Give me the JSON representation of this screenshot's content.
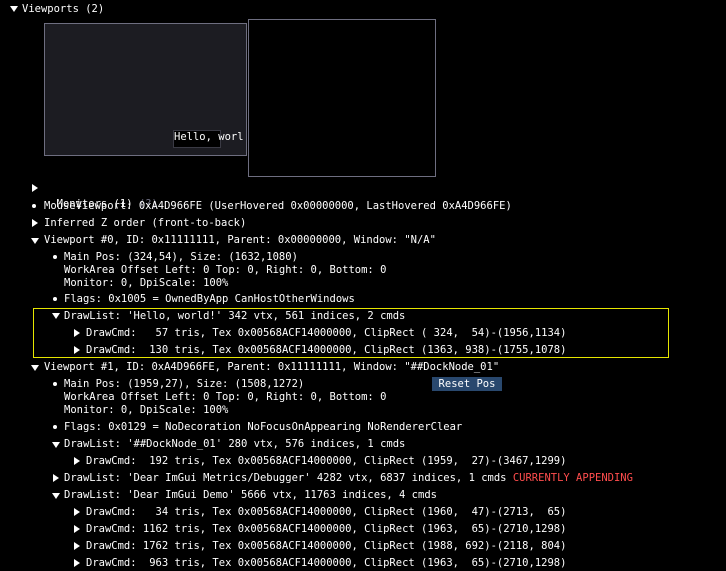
{
  "viewports_header": "Viewports (2)",
  "preview": {
    "hello_text": "Hello, worl"
  },
  "monitors": {
    "label": "Monitors (1)",
    "help": "(?)"
  },
  "mouse_viewport": "MouseViewport: 0xA4D966FE (UserHovered 0x00000000, LastHovered 0xA4D966FE)",
  "inferred_z": "Inferred Z order (front-to-back)",
  "viewport0": {
    "header": "Viewport #0, ID: 0x11111111, Parent: 0x00000000, Window: \"N/A\"",
    "pos_lines": [
      "Main Pos: (324,54), Size: (1632,1080)",
      "WorkArea Offset Left: 0 Top: 0, Right: 0, Bottom: 0",
      "Monitor: 0, DpiScale: 100%"
    ],
    "flags": "Flags: 0x1005 = OwnedByApp CanHostOtherWindows",
    "drawlist": "DrawList: 'Hello, world!' 342 vtx, 561 indices, 2 cmds",
    "drawcmds": [
      "DrawCmd:   57 tris, Tex 0x00568ACF14000000, ClipRect ( 324,  54)-(1956,1134)",
      "DrawCmd:  130 tris, Tex 0x00568ACF14000000, ClipRect (1363, 938)-(1755,1078)"
    ]
  },
  "viewport1": {
    "header": "Viewport #1, ID: 0xA4D966FE, Parent: 0x11111111, Window: \"##DockNode_01\"",
    "pos_lines": [
      "Main Pos: (1959,27), Size: (1508,1272)",
      "WorkArea Offset Left: 0 Top: 0, Right: 0, Bottom: 0",
      "Monitor: 0, DpiScale: 100%"
    ],
    "reset_pos": "Reset Pos",
    "flags": "Flags: 0x0129 = NoDecoration NoFocusOnAppearing NoRendererClear",
    "drawlist1": "DrawList: '##DockNode_01' 280 vtx, 576 indices, 1 cmds",
    "drawlist1_cmd": "DrawCmd:  192 tris, Tex 0x00568ACF14000000, ClipRect (1959,  27)-(3467,1299)",
    "drawlist2": "DrawList: 'Dear ImGui Metrics/Debugger' 4282 vtx, 6837 indices, 1 cmds",
    "drawlist2_status": "CURRENTLY APPENDING",
    "drawlist3": "DrawList: 'Dear ImGui Demo' 5666 vtx, 11763 indices, 4 cmds",
    "drawlist3_cmds": [
      "DrawCmd:   34 tris, Tex 0x00568ACF14000000, ClipRect (1960,  47)-(2713,  65)",
      "DrawCmd: 1162 tris, Tex 0x00568ACF14000000, ClipRect (1963,  65)-(2710,1298)",
      "DrawCmd: 1762 tris, Tex 0x00568ACF14000000, ClipRect (1988, 692)-(2118, 804)",
      "DrawCmd:  963 tris, Tex 0x00568ACF14000000, ClipRect (1963,  65)-(2710,1298)"
    ]
  },
  "colors": {
    "background": "#000000",
    "text": "#ffffff",
    "highlight": "#e6e600",
    "appending": "#ff4d4d",
    "button": "#29486e"
  }
}
